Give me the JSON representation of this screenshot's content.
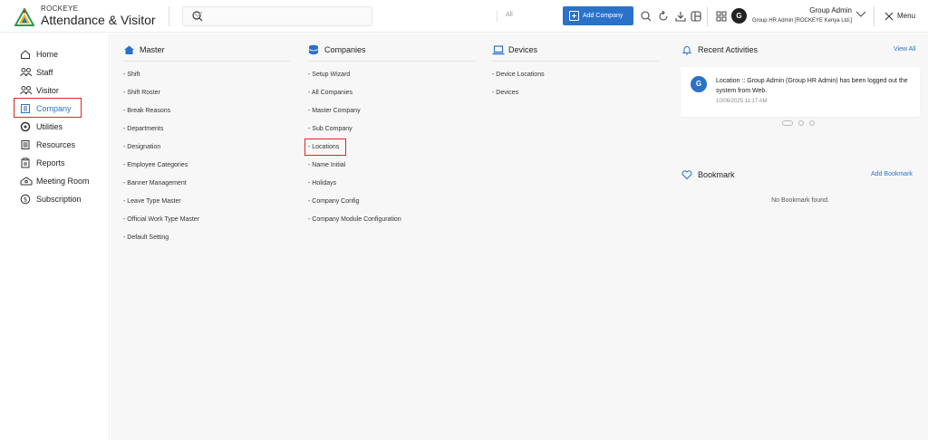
{
  "header": {
    "brand_top": "ROCKEYE",
    "brand_main": "Attendance & Visitor",
    "search_placeholder": "",
    "search_filter": "All",
    "add_company_label": "Add Company",
    "user_initial": "G",
    "user_name": "Group Admin",
    "user_role": "Group HR Admin [ROCKEYE Kenya Ltd.]",
    "menu_label": "Menu"
  },
  "sidebar": {
    "items": [
      {
        "label": "Home",
        "icon": "home-icon"
      },
      {
        "label": "Staff",
        "icon": "staff-icon"
      },
      {
        "label": "Visitor",
        "icon": "visitor-icon"
      },
      {
        "label": "Company",
        "icon": "company-icon",
        "active": true
      },
      {
        "label": "Utilities",
        "icon": "utilities-icon"
      },
      {
        "label": "Resources",
        "icon": "resources-icon"
      },
      {
        "label": "Reports",
        "icon": "reports-icon"
      },
      {
        "label": "Meeting Room",
        "icon": "meeting-room-icon"
      },
      {
        "label": "Subscription",
        "icon": "subscription-icon"
      }
    ]
  },
  "master": {
    "title": "Master",
    "links": [
      "- Shift",
      "- Shift Roster",
      "- Break Reasons",
      "- Departments",
      "- Designation",
      "- Employee Categories",
      "- Banner Management",
      "- Leave Type Master",
      "- Official Work Type Master",
      "- Default Setting"
    ]
  },
  "companies": {
    "title": "Companies",
    "links": [
      "- Setup Wizard",
      "- All Companies",
      "- Master Company",
      "- Sub Company",
      "- Locations",
      "- Name Initial",
      "- Holidays",
      "- Company Config",
      "- Company Module Configuration"
    ]
  },
  "devices": {
    "title": "Devices",
    "links": [
      "- Device Locations",
      "- Devices"
    ]
  },
  "recent": {
    "title": "Recent Activities",
    "view_all": "View All",
    "activity_initial": "G",
    "activity_text": "Location :: Group Admin (Group HR Admin) has been logged out the system from Web.",
    "activity_time": "10/06/2025 11:17 AM"
  },
  "bookmark": {
    "title": "Bookmark",
    "add_label": "Add Bookmark",
    "empty_text": "No Bookmark found."
  },
  "colors": {
    "accent": "#2a72c9",
    "highlight": "#e02424"
  }
}
